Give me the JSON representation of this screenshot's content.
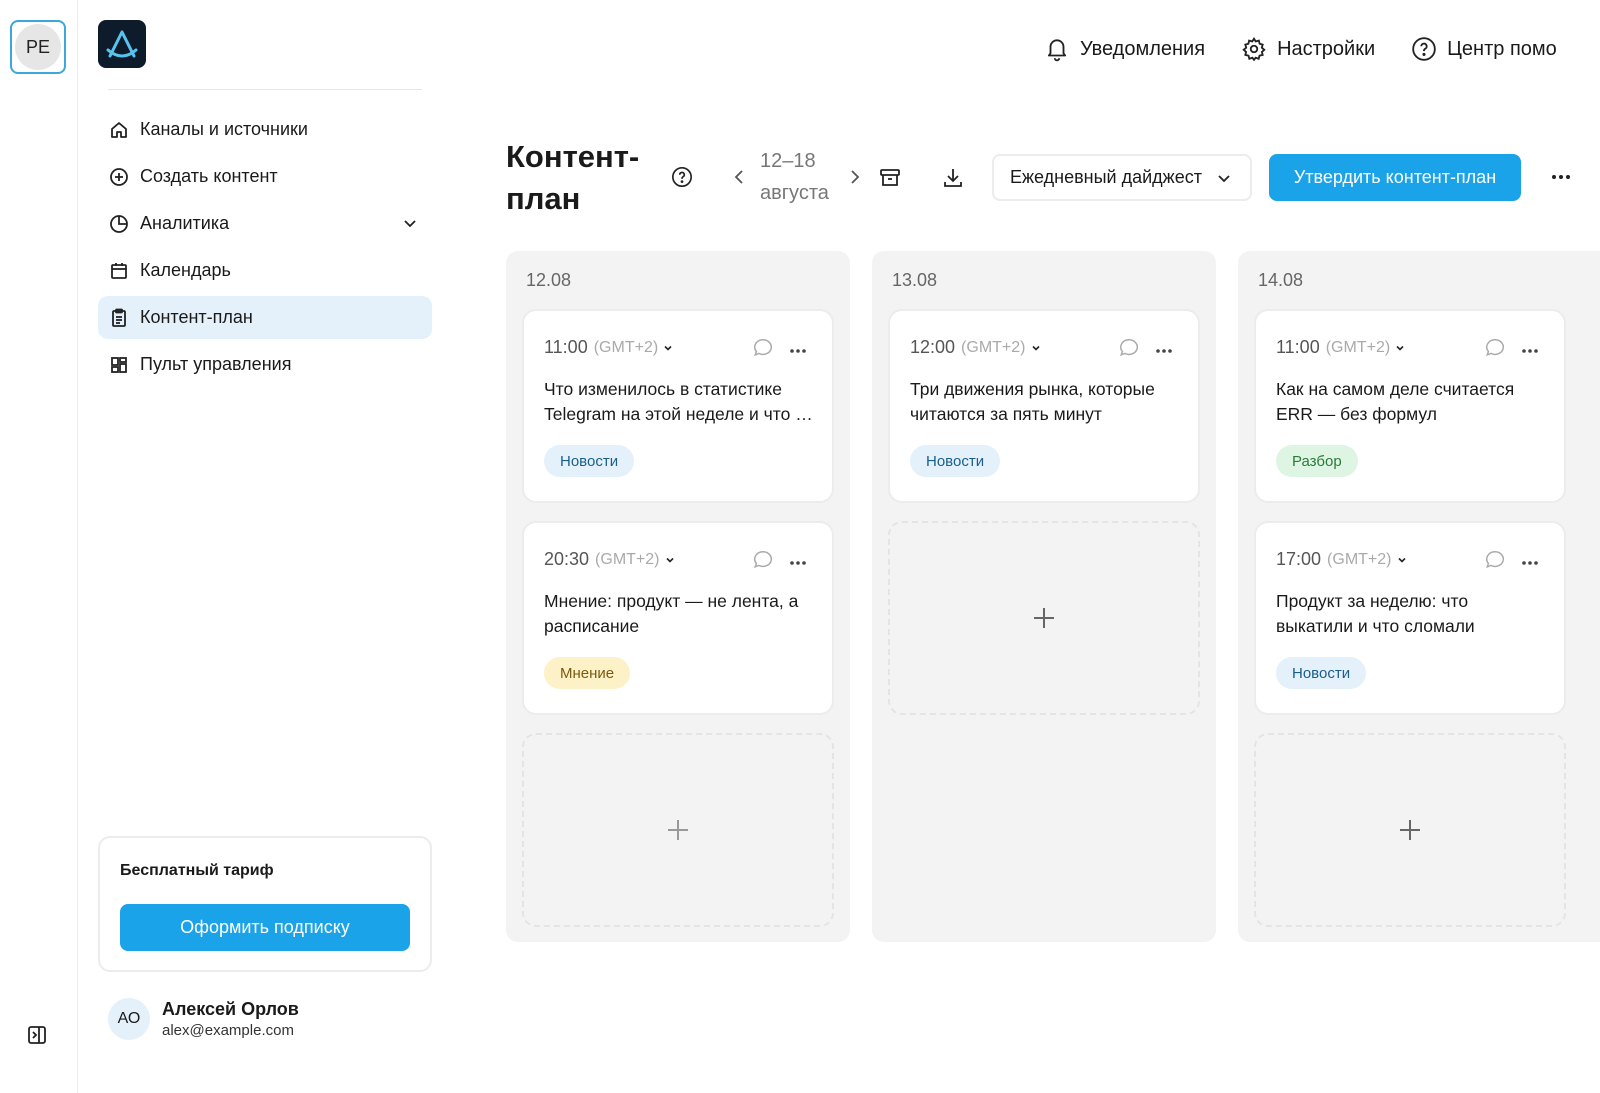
{
  "workspace": {
    "initials": "PE"
  },
  "sidebar": {
    "items": [
      {
        "label": "Каналы и источники",
        "icon": "home-icon"
      },
      {
        "label": "Создать контент",
        "icon": "plus-circle-icon"
      },
      {
        "label": "Аналитика",
        "icon": "pie-chart-icon"
      },
      {
        "label": "Календарь",
        "icon": "calendar-icon"
      },
      {
        "label": "Контент-план",
        "icon": "clipboard-icon",
        "active": true
      },
      {
        "label": "Пульт управления",
        "icon": "dashboard-icon"
      }
    ],
    "plan": {
      "title": "Бесплатный тариф",
      "button": "Оформить подписку"
    },
    "user": {
      "initials": "АО",
      "name": "Алексей Орлов",
      "email": "alex@example.com"
    }
  },
  "topnav": {
    "notifications": "Уведомления",
    "settings": "Настройки",
    "help": "Центр помо"
  },
  "header": {
    "title": "Контент-план",
    "date_range": "12–18 августа",
    "format_select": "Ежедневный дайджест",
    "approve_button": "Утвердить контент-план"
  },
  "colors": {
    "accent": "#1aa3e8",
    "active_bg": "#e4f1fb"
  },
  "columns": [
    {
      "date": "12.08",
      "posts": [
        {
          "time": "11:00",
          "tz": "(GMT+2)",
          "title": "Что изменилось в статистике Telegram на этой неделе и что с этим делать",
          "tag": "Новости",
          "tag_type": "news"
        },
        {
          "time": "20:30",
          "tz": "(GMT+2)",
          "title": "Мнение: продукт — не лента, а расписание",
          "tag": "Мнение",
          "tag_type": "opinion"
        }
      ]
    },
    {
      "date": "13.08",
      "posts": [
        {
          "time": "12:00",
          "tz": "(GMT+2)",
          "title": "Три движения рынка, которые читаются за пять минут",
          "tag": "Новости",
          "tag_type": "news"
        }
      ]
    },
    {
      "date": "14.08",
      "posts": [
        {
          "time": "11:00",
          "tz": "(GMT+2)",
          "title": "Как на самом деле считается ERR — без формул",
          "tag": "Разбор",
          "tag_type": "analysis"
        },
        {
          "time": "17:00",
          "tz": "(GMT+2)",
          "title": "Продукт за неделю: что выкатили и что сломали",
          "tag": "Новости",
          "tag_type": "news"
        }
      ]
    }
  ]
}
